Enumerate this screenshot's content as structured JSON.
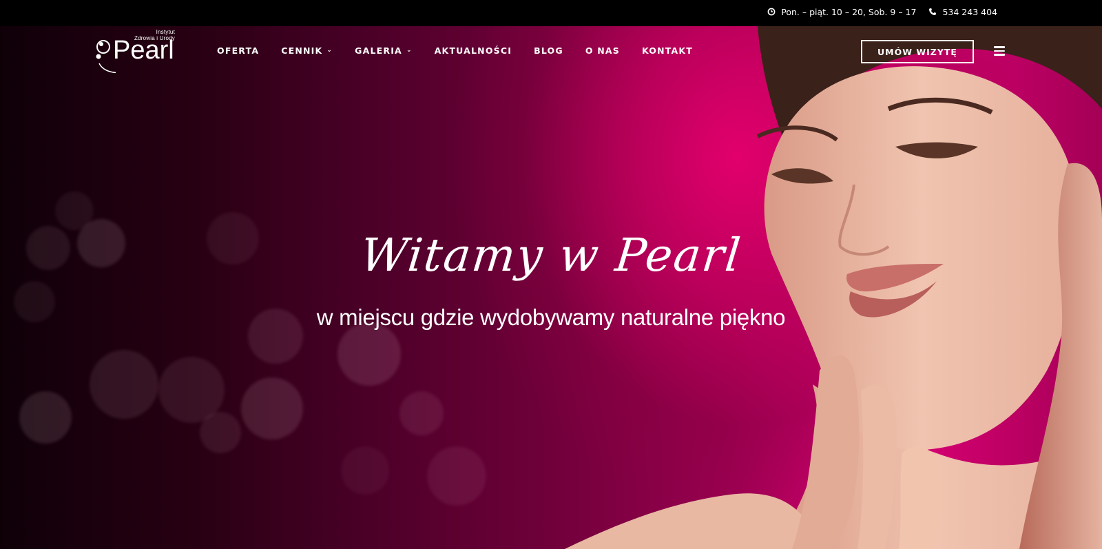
{
  "topbar": {
    "hours_icon": "clock-icon",
    "hours": "Pon. – piąt. 10 – 20, Sob. 9 – 17",
    "phone_icon": "phone-icon",
    "phone": "534 243 404"
  },
  "logo": {
    "line1": "Instytut",
    "line2": "Zdrowia i Urody",
    "name": "Pearl"
  },
  "nav": {
    "items": [
      {
        "label": "OFERTA",
        "dropdown": false
      },
      {
        "label": "CENNIK",
        "dropdown": true
      },
      {
        "label": "GALERIA",
        "dropdown": true
      },
      {
        "label": "AKTUALNOŚCI",
        "dropdown": false
      },
      {
        "label": "BLOG",
        "dropdown": false
      },
      {
        "label": "O NAS",
        "dropdown": false
      },
      {
        "label": "KONTAKT",
        "dropdown": false
      }
    ],
    "chevron": "⌄"
  },
  "cta": {
    "label": "UMÓW WIZYTĘ"
  },
  "menu_icon": "hamburger-menu-icon",
  "hero": {
    "title": "Witamy w Pearl",
    "subtitle": "w miejscu gdzie wydobywamy naturalne piękno"
  },
  "colors": {
    "accent": "#d40070",
    "dark": "#1a000c",
    "topbar": "#000000"
  }
}
